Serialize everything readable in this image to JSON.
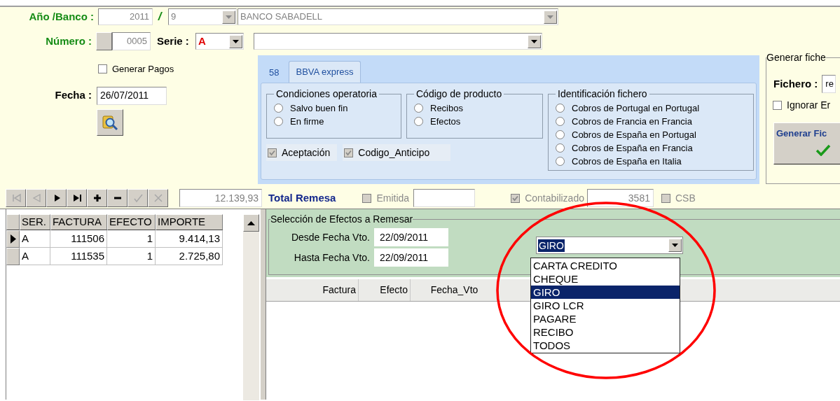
{
  "header": {
    "year_bank_label": "Año /Banco :",
    "year": "2011",
    "separator": "/",
    "bank_code": "9",
    "bank_name": "BANCO SABADELL",
    "number_label": "Número :",
    "number": "0005",
    "serie_label": "Serie :",
    "serie": "A"
  },
  "generar_pagos": {
    "label": "Generar Pagos",
    "checked": false
  },
  "fecha": {
    "label": "Fecha :",
    "value": "26/07/2011"
  },
  "tabs": [
    {
      "label": "58",
      "selected": false
    },
    {
      "label": "BBVA express",
      "selected": true
    }
  ],
  "groups": [
    {
      "title": "Condiciones operatoria",
      "options": [
        {
          "label": "Salvo buen fin",
          "selected": false
        },
        {
          "label": "En firme",
          "selected": false
        }
      ]
    },
    {
      "title": "Código de producto",
      "options": [
        {
          "label": "Recibos",
          "selected": false
        },
        {
          "label": "Efectos",
          "selected": false
        }
      ]
    },
    {
      "title": "Identificación fichero",
      "options": [
        {
          "label": "Cobros de Portugal en Portugal",
          "selected": false
        },
        {
          "label": "Cobros de Francia en Francia",
          "selected": false
        },
        {
          "label": "Cobros de España en Portugal",
          "selected": false
        },
        {
          "label": "Cobros de España en Francia",
          "selected": false
        },
        {
          "label": "Cobros de España en Italia",
          "selected": false
        }
      ]
    }
  ],
  "tab_checkboxes": [
    {
      "label": "Aceptación",
      "checked": true,
      "disabled": true
    },
    {
      "label": "Codigo_Anticipo",
      "checked": true,
      "disabled": true
    }
  ],
  "generar_fichero": {
    "title": "Generar fiche",
    "fichero_label": "Fichero :",
    "fichero": "re",
    "ignorar": {
      "label": "Ignorar Er",
      "checked": false
    },
    "button": "Generar Fic"
  },
  "navigator": [
    {
      "kind": "first",
      "disabled": true
    },
    {
      "kind": "prior",
      "disabled": true
    },
    {
      "kind": "next",
      "disabled": false
    },
    {
      "kind": "last",
      "disabled": false
    },
    {
      "kind": "insert",
      "disabled": false
    },
    {
      "kind": "delete",
      "disabled": false
    },
    {
      "kind": "post",
      "disabled": true
    },
    {
      "kind": "cancel",
      "disabled": true
    }
  ],
  "totals": {
    "total": "12.139,93",
    "label": "Total Remesa",
    "emitida": {
      "label": "Emitida",
      "checked": false,
      "disabled": true
    },
    "contabilizado": {
      "label": "Contabilizado",
      "checked": true,
      "disabled": true
    },
    "contabilizado_value": "3581",
    "csb": {
      "label": "CSB",
      "checked": false,
      "disabled": true
    }
  },
  "remesa_grid": {
    "columns": [
      "SER.",
      "FACTURA",
      "EFECTO",
      "IMPORTE"
    ],
    "rows": [
      {
        "selected": true,
        "cells": [
          "A",
          "111506",
          "1",
          "9.414,13"
        ]
      },
      {
        "selected": false,
        "cells": [
          "A",
          "111535",
          "1",
          "2.725,80"
        ]
      }
    ]
  },
  "seleccion": {
    "title": "Selección de Efectos a Remesar",
    "desde_label": "Desde Fecha Vto.",
    "desde": "22/09/2011",
    "hasta_label": "Hasta Fecha Vto.",
    "hasta": "22/09/2011",
    "tipo": "GIRO",
    "tipo_options": [
      {
        "label": "CARTA CREDITO",
        "selected": false
      },
      {
        "label": "CHEQUE",
        "selected": false
      },
      {
        "label": "GIRO",
        "selected": true
      },
      {
        "label": "GIRO LCR",
        "selected": false
      },
      {
        "label": "PAGARE",
        "selected": false
      },
      {
        "label": "RECIBO",
        "selected": false
      },
      {
        "label": "TODOS",
        "selected": false
      }
    ],
    "columns": [
      "Factura",
      "Efecto",
      "Fecha_Vto"
    ]
  }
}
